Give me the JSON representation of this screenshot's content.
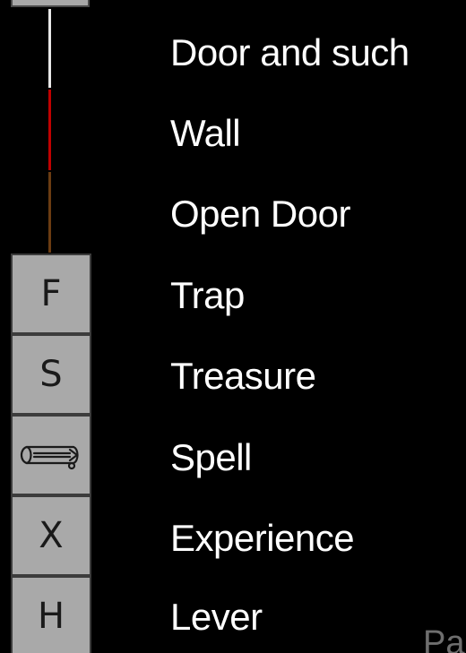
{
  "legend": {
    "items": [
      {
        "label": "Door and such",
        "marker": "line",
        "color": "#e8e8e8"
      },
      {
        "label": "Wall",
        "marker": "line",
        "color": "#c00000"
      },
      {
        "label": "Open Door",
        "marker": "line",
        "color": "#6b3c12"
      },
      {
        "label": "Trap",
        "marker": "tile",
        "glyph": "F"
      },
      {
        "label": "Treasure",
        "marker": "tile",
        "glyph": "S"
      },
      {
        "label": "Spell",
        "marker": "tile",
        "icon": "scroll-icon"
      },
      {
        "label": "Experience",
        "marker": "tile",
        "glyph": "X"
      },
      {
        "label": "Lever",
        "marker": "tile",
        "glyph": "H"
      }
    ]
  },
  "corner_text": "Pa",
  "colors": {
    "background": "#000000",
    "tile_fill": "#a9a9a9",
    "tile_border": "#3c3c3c",
    "label_text": "#ffffff"
  }
}
